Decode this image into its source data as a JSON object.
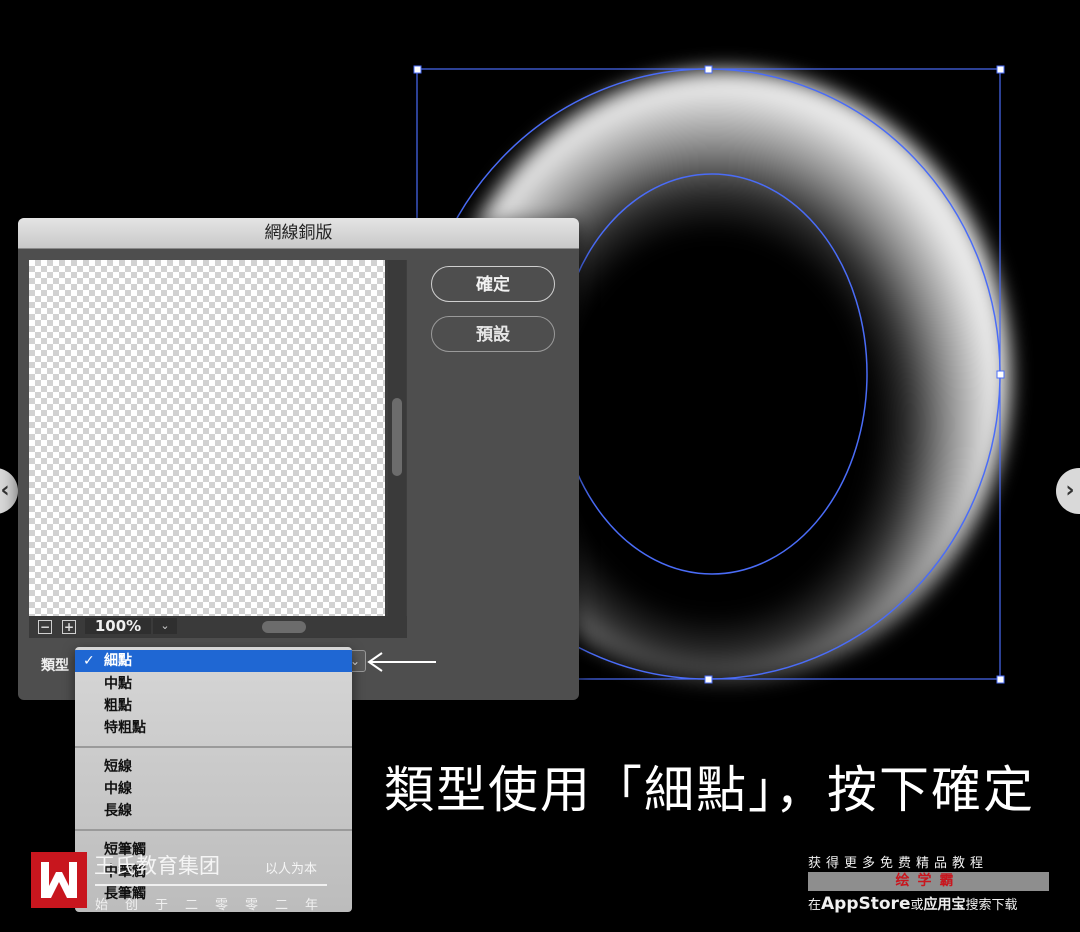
{
  "dialog": {
    "title": "網線銅版",
    "ok_label": "確定",
    "default_label": "預設",
    "zoom_minus": "−",
    "zoom_plus": "+",
    "zoom_value": "100%",
    "type_label": "類型"
  },
  "menu": {
    "items": [
      "細點",
      "中點",
      "粗點",
      "特粗點",
      "短線",
      "中線",
      "長線",
      "短筆觸",
      "中筆觸",
      "長筆觸"
    ],
    "selected": "細點"
  },
  "caption": "類型使用「細點」，按下確定",
  "watermark": {
    "company": "王氏教育集团",
    "slogan": "以人为本",
    "founded": "始创于二零零二年"
  },
  "promo": {
    "line1": "获得更多免费精品教程",
    "brand": "绘学霸",
    "line3_prefix": "在",
    "line3_store": "AppStore",
    "line3_or": "或",
    "line3_app": "应用宝",
    "line3_suffix": "搜索下载"
  },
  "colors": {
    "accent_blue": "#1f67d3",
    "bounding_box": "#4a6cf7",
    "brand_red": "#c8161e"
  },
  "icons": [
    "check-icon",
    "arrow-left-icon",
    "chevron-down-icon",
    "nav-prev-icon",
    "nav-next-icon"
  ]
}
